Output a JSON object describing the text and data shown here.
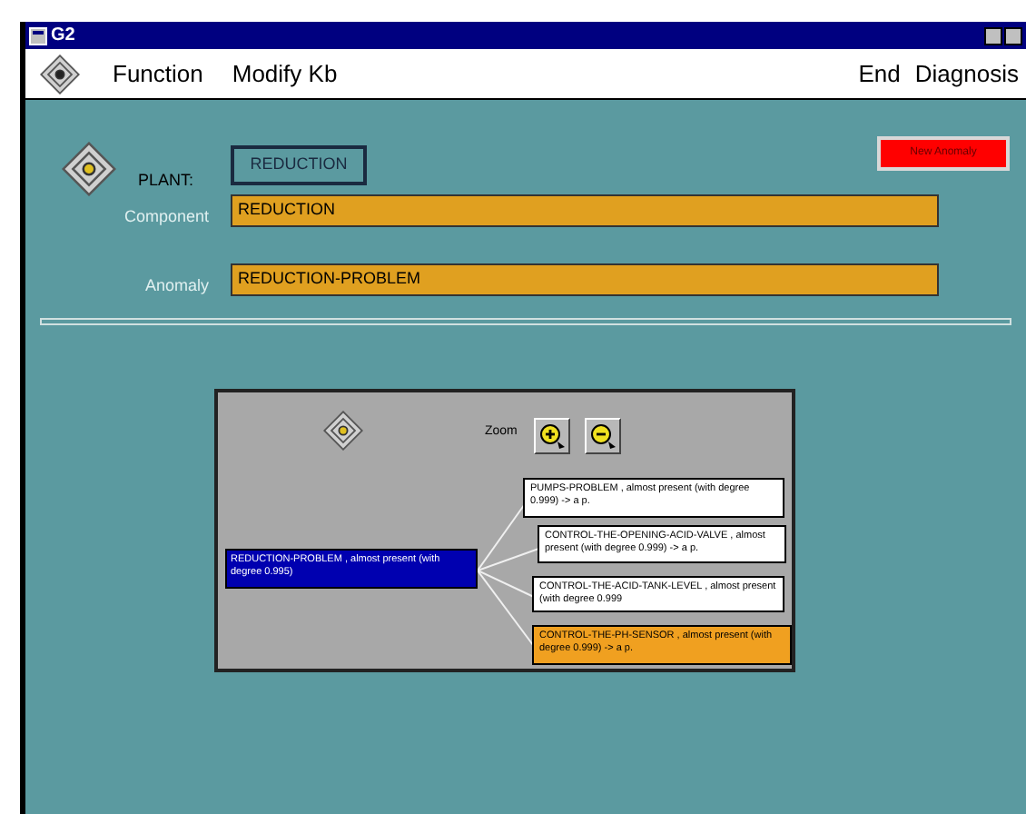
{
  "window": {
    "title": "G2"
  },
  "menu": {
    "left": [
      "Function",
      "Modify Kb"
    ],
    "right": [
      "End",
      "Diagnosis"
    ]
  },
  "form": {
    "plant_label": "PLANT:",
    "plant": "REDUCTION",
    "new_button": "New Anomaly",
    "component_label": "Component",
    "component": "REDUCTION",
    "anomaly_label": "Anomaly",
    "anomaly": "REDUCTION-PROBLEM"
  },
  "diagram": {
    "zoom_label": "Zoom",
    "root": {
      "text": "REDUCTION-PROBLEM ,  almost present (with degree 0.995)"
    },
    "children": [
      {
        "text": "PUMPS-PROBLEM ,  almost present (with degree 0.999) -> a p.",
        "color": "#ffffff"
      },
      {
        "text": "CONTROL-THE-OPENING-ACID-VALVE ,  almost present (with degree 0.999) -> a p.",
        "color": "#ffffff"
      },
      {
        "text": "CONTROL-THE-ACID-TANK-LEVEL ,  almost present (with degree 0.999",
        "color": "#ffffff"
      },
      {
        "text": "CONTROL-THE-PH-SENSOR ,  almost present (with degree 0.999) -> a p.",
        "color": "#f0a020"
      }
    ]
  }
}
